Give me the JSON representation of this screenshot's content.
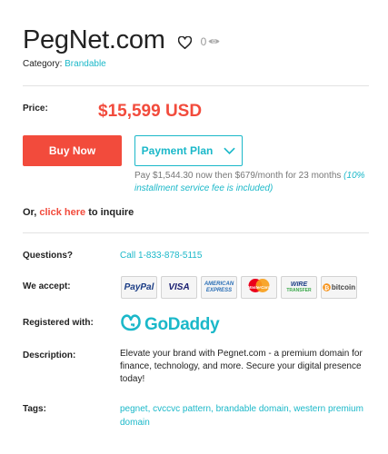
{
  "domain": {
    "title": "PegNet.com",
    "views": "0",
    "category_label": "Category:",
    "category_value": "Brandable"
  },
  "pricing": {
    "label": "Price:",
    "value": "$15,599 USD",
    "buy_now": "Buy Now",
    "payment_plan": "Payment Plan",
    "plan_text": "Pay $1,544.30 now then $679/month for 23 months",
    "plan_fee": "(10% installment service fee is included)"
  },
  "inquire": {
    "prefix": "Or,",
    "link": "click here",
    "suffix": "to inquire"
  },
  "details": {
    "questions_label": "Questions?",
    "phone": "Call 1-833-878-5115",
    "accept_label": "We accept:",
    "payment_methods": {
      "paypal": "PayPal",
      "visa": "VISA",
      "amex_line1": "AMERICAN",
      "amex_line2": "EXPRESS",
      "mastercard": "MasterCard",
      "wire_line1": "WIRE",
      "wire_line2": "TRANSFER",
      "bitcoin": "bitcoin"
    },
    "registered_label": "Registered with:",
    "registrar": "GoDaddy",
    "description_label": "Description:",
    "description": "Elevate your brand with Pegnet.com - a premium domain for finance, technology, and more. Secure your digital presence today!",
    "tags_label": "Tags:",
    "tags": "pegnet, cvccvc pattern, brandable domain, western premium domain"
  },
  "colors": {
    "accent_red": "#f24b3c",
    "accent_teal": "#1bb8c9"
  },
  "icons": [
    "heart-icon",
    "eye-icon",
    "chevron-down-icon",
    "godaddy-logo-icon",
    "bitcoin-icon",
    "mastercard-icon"
  ]
}
